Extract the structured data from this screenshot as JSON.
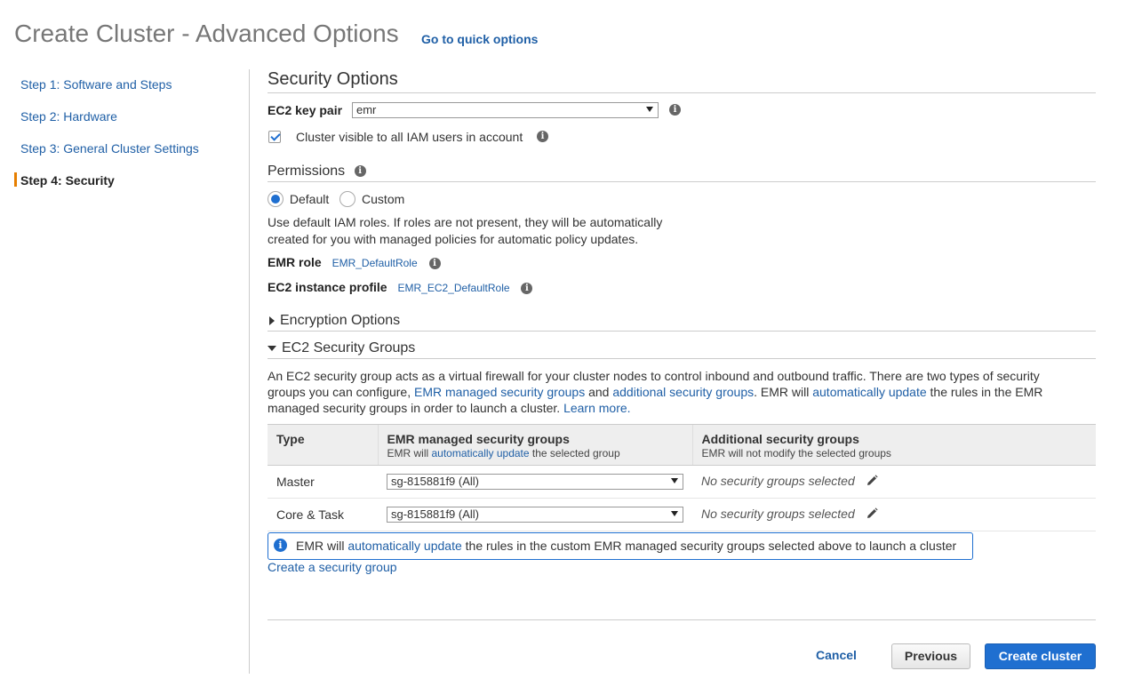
{
  "header": {
    "title": "Create Cluster - Advanced Options",
    "quick_link": "Go to quick options"
  },
  "steps": [
    {
      "label": "Step 1: Software and Steps",
      "active": false
    },
    {
      "label": "Step 2: Hardware",
      "active": false
    },
    {
      "label": "Step 3: General Cluster Settings",
      "active": false
    },
    {
      "label": "Step 4: Security",
      "active": true
    }
  ],
  "security": {
    "title": "Security Options",
    "key_pair_label": "EC2 key pair",
    "key_pair_value": "emr",
    "visible_label": "Cluster visible to all IAM users in account",
    "visible_checked": true
  },
  "permissions": {
    "title": "Permissions",
    "default_label": "Default",
    "custom_label": "Custom",
    "selected": "Default",
    "description_line1": "Use default IAM roles. If roles are not present, they will be automatically",
    "description_line2": "created for you with managed policies for automatic policy updates.",
    "emr_role_label": "EMR role",
    "emr_role_value": "EMR_DefaultRole",
    "instance_profile_label": "EC2 instance profile",
    "instance_profile_value": "EMR_EC2_DefaultRole"
  },
  "encryption": {
    "title": "Encryption Options",
    "expanded": false
  },
  "security_groups": {
    "title": "EC2 Security Groups",
    "expanded": true,
    "desc": {
      "p1": "An EC2 security group acts as a virtual firewall for your cluster nodes to control inbound and outbound traffic. There are two types of security",
      "p2": "groups you can configure, ",
      "link1": "EMR managed security groups",
      "p3": " and ",
      "link2": "additional security groups",
      "p4": ". EMR will ",
      "link3": "automatically update",
      "p5": " the rules in the EMR",
      "p6": "managed security groups in order to launch a cluster. ",
      "link4": "Learn more."
    },
    "table": {
      "col_type": "Type",
      "col_emr": "EMR managed security groups",
      "col_emr_sub_pre": "EMR will ",
      "col_emr_sub_link": "automatically update",
      "col_emr_sub_post": " the selected group",
      "col_add": "Additional security groups",
      "col_add_sub": "EMR will not modify the selected groups",
      "rows": [
        {
          "type": "Master",
          "emr_group": "sg-815881f9 (All)",
          "additional": "No security groups selected"
        },
        {
          "type": "Core & Task",
          "emr_group": "sg-815881f9 (All)",
          "additional": "No security groups selected"
        }
      ]
    },
    "alert_pre": "EMR will ",
    "alert_link": "automatically update",
    "alert_post": " the rules in the custom EMR managed security groups selected above to launch a cluster",
    "create_link": "Create a security group"
  },
  "footer": {
    "cancel": "Cancel",
    "previous": "Previous",
    "create": "Create cluster"
  },
  "colors": {
    "accent": "#1f6fd0",
    "link": "#1f5fa6",
    "active_step_marker": "#e67e00"
  }
}
